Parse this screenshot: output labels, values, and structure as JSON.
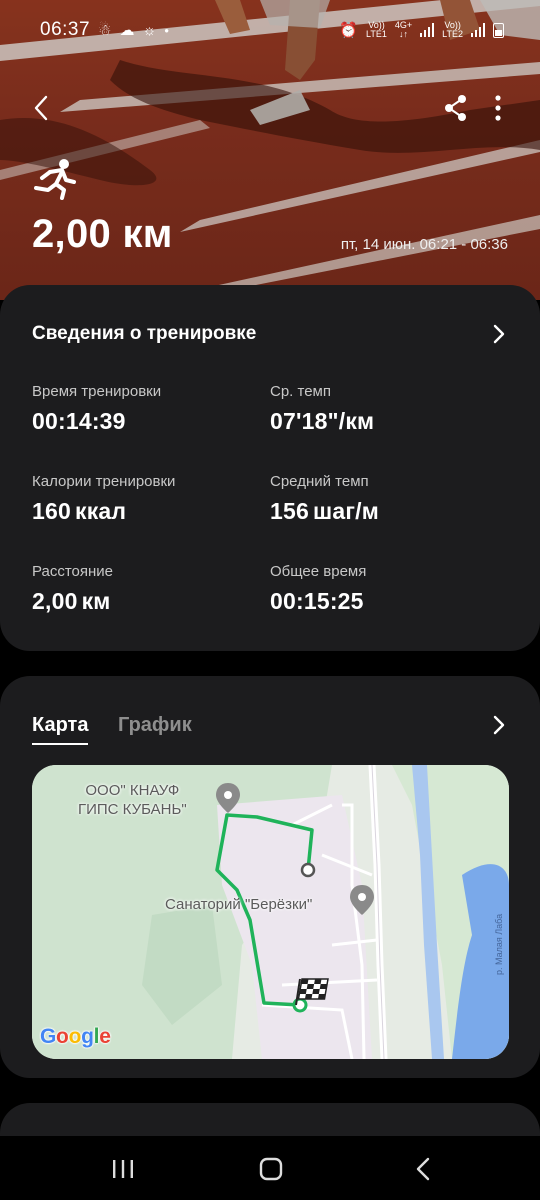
{
  "status_bar": {
    "time": "06:37",
    "icons": [
      "snapchat-icon",
      "cloud-icon",
      "sun-icon",
      "dot-icon",
      "alarm-icon",
      "signal-icon",
      "battery-icon"
    ],
    "sim1": "LTE1",
    "sim2": "LTE2",
    "net": "4G+"
  },
  "hero": {
    "distance": "2,00 км",
    "datetime": "пт, 14 июн. 06:21 - 06:36",
    "activity_icon": "running-icon"
  },
  "workout_details": {
    "title": "Сведения о тренировке",
    "stats": [
      {
        "label": "Время тренировки",
        "value": "00:14:39",
        "unit": ""
      },
      {
        "label": "Ср. темп",
        "value": "07'18\"/км",
        "unit": ""
      },
      {
        "label": "Калории тренировки",
        "value": "160",
        "unit": "ккал"
      },
      {
        "label": "Средний темп",
        "value": "156",
        "unit": "шаг/м"
      },
      {
        "label": "Расстояние",
        "value": "2,00",
        "unit": "км"
      },
      {
        "label": "Общее время",
        "value": "00:15:25",
        "unit": ""
      }
    ]
  },
  "map_card": {
    "tabs": [
      {
        "label": "Карта",
        "active": true
      },
      {
        "label": "График",
        "active": false
      }
    ],
    "labels": {
      "poi1": "ООО\" КНАУФ\nГИПС КУБАНЬ\"",
      "poi2": "Санаторий \"Берёзки\"",
      "river": "р. Малая Лаба",
      "attribution": "Google"
    },
    "route_color": "#22b04a"
  },
  "colors": {
    "accent_track": "#8a3320",
    "card_bg": "#1c1c1e"
  }
}
